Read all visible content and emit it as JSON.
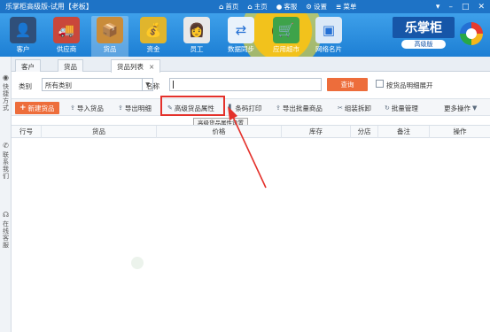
{
  "titlebar": {
    "app_title": "乐掌柜高级版-试用【老板】",
    "links": [
      {
        "icon": "home-icon",
        "glyph": "⌂",
        "label": "首页"
      },
      {
        "icon": "home-icon",
        "glyph": "⌂",
        "label": "主页"
      },
      {
        "icon": "chat-icon",
        "glyph": "●",
        "label": "客服"
      },
      {
        "icon": "gear-icon",
        "glyph": "⚙",
        "label": "设置"
      },
      {
        "icon": "menu-icon",
        "glyph": "≡",
        "label": "菜单"
      }
    ],
    "window_buttons": [
      {
        "name": "skin-icon",
        "glyph": "▾"
      },
      {
        "name": "minimize-icon",
        "glyph": "–"
      },
      {
        "name": "maximize-icon",
        "glyph": "□"
      },
      {
        "name": "close-icon",
        "glyph": "✕"
      }
    ]
  },
  "modules": [
    {
      "label": "客户",
      "icon": "customer-icon",
      "glyph": "👤",
      "color": "#2f4f7a"
    },
    {
      "label": "供应商",
      "icon": "supplier-icon",
      "glyph": "🚚",
      "color": "#c9473b"
    },
    {
      "label": "货品",
      "icon": "goods-icon",
      "glyph": "📦",
      "color": "#c98c3a"
    },
    {
      "label": "资金",
      "icon": "money-icon",
      "glyph": "💰",
      "color": "#e0b52d"
    },
    {
      "label": "员工",
      "icon": "staff-icon",
      "glyph": "👩",
      "color": "#e8e8e8"
    },
    {
      "label": "数据同步",
      "icon": "sync-icon",
      "glyph": "⇄",
      "color": "#e9f2fb"
    },
    {
      "label": "应用超市",
      "icon": "store-icon",
      "glyph": "🛒",
      "color": "#3ea34a"
    },
    {
      "label": "网络名片",
      "icon": "card-icon",
      "glyph": "▣",
      "color": "#dce9f7"
    }
  ],
  "brand": {
    "name": "乐掌柜",
    "edition": "高级版"
  },
  "sidebar": {
    "items": [
      {
        "icon": "shortcut-icon",
        "glyph": "◉",
        "label": "快捷方式"
      },
      {
        "icon": "phone-icon",
        "glyph": "✆",
        "label": "联系我们"
      },
      {
        "icon": "headset-icon",
        "glyph": "☊",
        "label": "在线客服"
      }
    ]
  },
  "tabs": [
    {
      "label": "客户",
      "active": false
    },
    {
      "label": "货品",
      "active": false
    },
    {
      "label": "货品列表",
      "active": true,
      "close": "×"
    }
  ],
  "filter": {
    "category_label": "类别",
    "category_value": "所有类别",
    "name_label": "名称",
    "name_value": "",
    "query_button": "查询",
    "expand_checkbox_label": "按货品明细展开"
  },
  "toolbar": {
    "new_goods": "新建货品",
    "import_goods": "导入货品",
    "export_detail": "导出明细",
    "advanced_attributes": "高级货品属性",
    "barcode_print": "条码打印",
    "export_selected": "导出批量商品",
    "assemble_split": "组装拆卸",
    "batch_manage": "批量管理",
    "more_actions": "更多操作"
  },
  "tooltip": "高级货品属性设置",
  "table": {
    "headers": [
      "行号",
      "货品",
      "价格",
      "库存",
      "分店",
      "备注",
      "操作"
    ],
    "rows": []
  },
  "colors": {
    "titlebar": "#1e73c6",
    "accent": "#ed6d3b",
    "highlight": "#e4312b"
  }
}
